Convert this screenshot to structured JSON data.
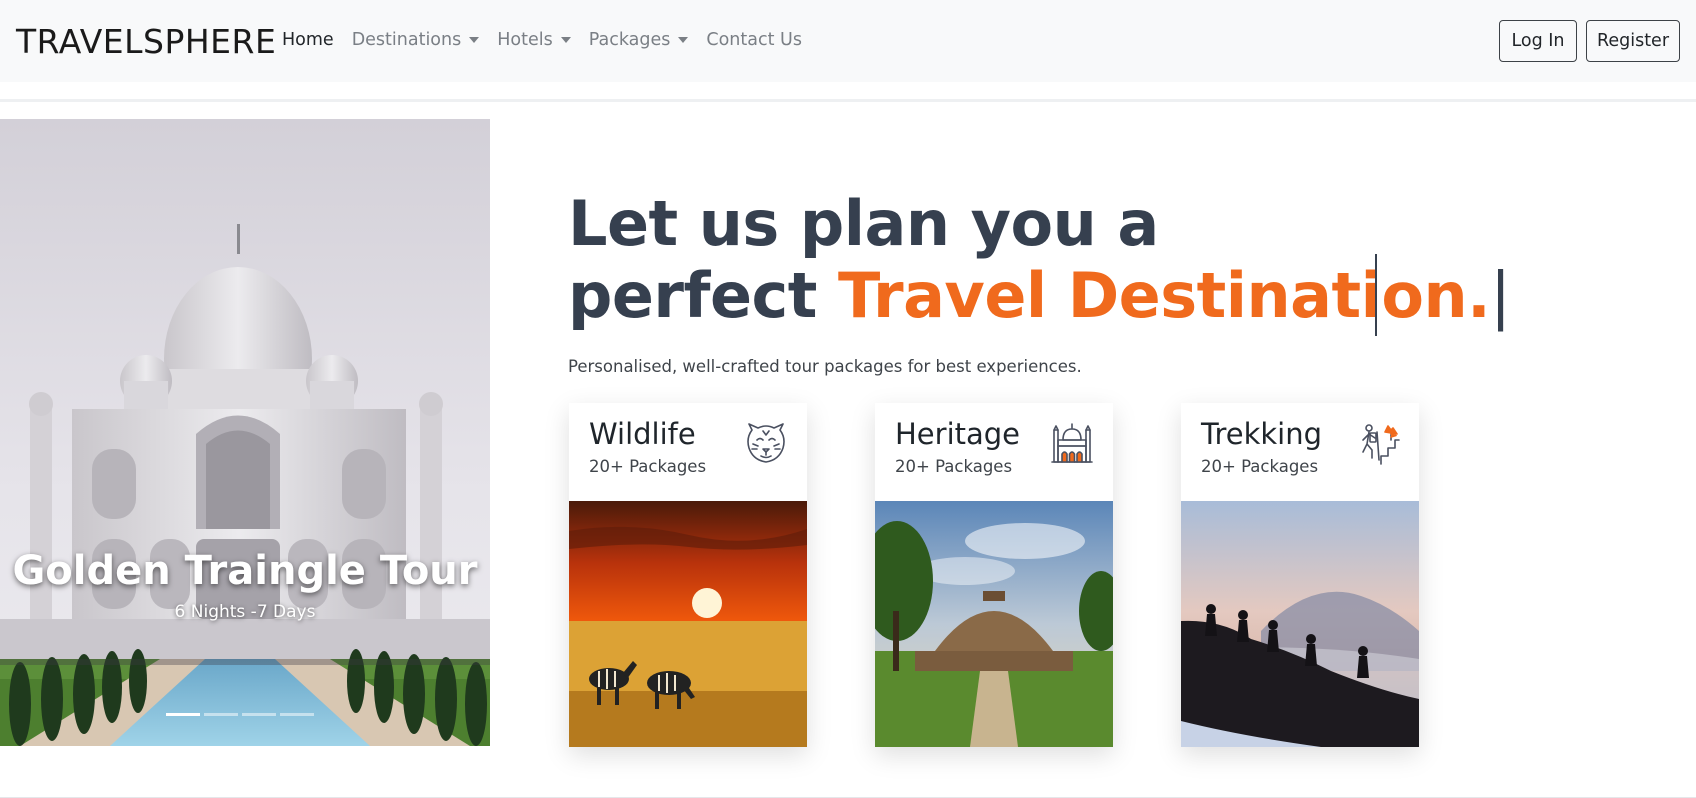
{
  "brand": "TRAVELSPHERE",
  "nav": {
    "items": [
      {
        "label": "Home",
        "active": true,
        "dropdown": false
      },
      {
        "label": "Destinations",
        "active": false,
        "dropdown": true
      },
      {
        "label": "Hotels",
        "active": false,
        "dropdown": true
      },
      {
        "label": "Packages",
        "active": false,
        "dropdown": true
      },
      {
        "label": "Contact Us",
        "active": false,
        "dropdown": false
      }
    ],
    "login_label": "Log In",
    "register_label": "Register"
  },
  "carousel": {
    "title": "Golden Traingle Tour",
    "subtitle": "6 Nights -7 Days",
    "slide_count": 4,
    "active_slide": 1
  },
  "hero": {
    "title_line1": "Let us plan you a",
    "title_line2_plain": "perfect ",
    "title_line2_accent": "Travel Destination.",
    "cursor": "|",
    "subtitle": "Personalised, well-crafted tour packages for best experiences."
  },
  "categories": [
    {
      "title": "Wildlife",
      "count": "20+ Packages",
      "icon": "tiger-icon"
    },
    {
      "title": "Heritage",
      "count": "20+ Packages",
      "icon": "monument-icon"
    },
    {
      "title": "Trekking",
      "count": "20+ Packages",
      "icon": "hiker-icon"
    }
  ],
  "colors": {
    "accent": "#f06a1d",
    "heading": "#36404f",
    "navbar_bg": "#f8f9fa",
    "icon_stroke": "#4a5060"
  }
}
